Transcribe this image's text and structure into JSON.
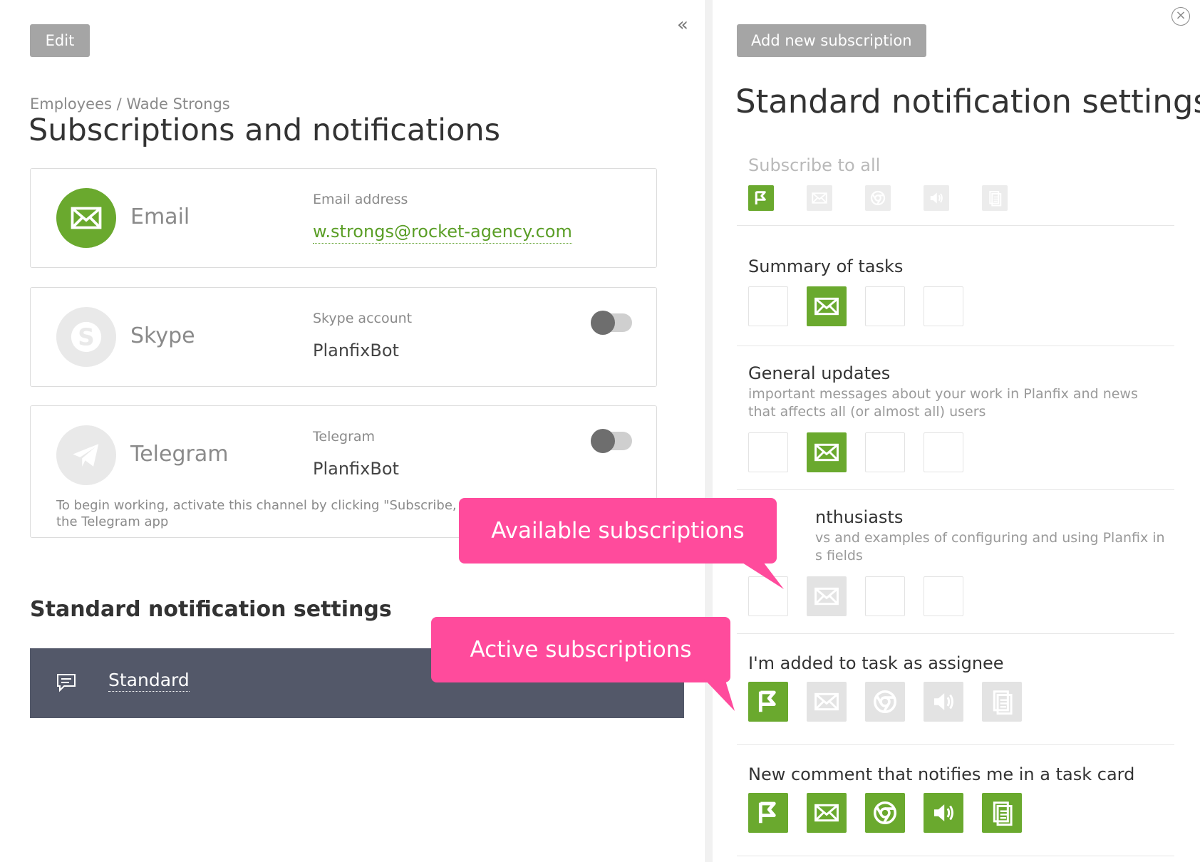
{
  "left": {
    "edit_label": "Edit",
    "collapse_icon": "«",
    "breadcrumb": "Employees / Wade Strongs",
    "title": "Subscriptions and notifications",
    "channels": {
      "email": {
        "name": "Email",
        "field_label": "Email address",
        "value": "w.strongs@rocket-agency.com",
        "icon": "envelope-icon"
      },
      "skype": {
        "name": "Skype",
        "field_label": "Skype account",
        "value": "PlanfixBot",
        "icon": "skype-icon",
        "enabled": false
      },
      "telegram": {
        "name": "Telegram",
        "field_label": "Telegram",
        "value": "PlanfixBot",
        "icon": "telegram-icon",
        "enabled": false,
        "note": "To begin working, activate this channel by clicking \"Subscribe,\" an",
        "note_line2": "the Telegram app"
      }
    },
    "standard_heading": "Standard notification settings",
    "standard_item": "Standard"
  },
  "right": {
    "close_icon": "×",
    "add_button": "Add new subscription",
    "title": "Standard notification settings",
    "sections": {
      "all": {
        "title": "Subscribe to all"
      },
      "summary": {
        "title": "Summary of tasks"
      },
      "general": {
        "title": "General updates",
        "desc": "important messages about your work in Planfix and news that affects all (or almost all) users"
      },
      "enthusiasts": {
        "title": "nthusiasts",
        "desc_line1": "vs and examples of configuring and using Planfix in",
        "desc_line2": "s fields"
      },
      "assignee": {
        "title": "I'm added to task as assignee"
      },
      "comment": {
        "title": "New comment that notifies me in a task card"
      }
    }
  },
  "callouts": {
    "available": "Available subscriptions",
    "active": "Active subscriptions"
  },
  "colors": {
    "accent": "#6aa92e",
    "callout": "#ff4b9c",
    "bar": "#535869"
  }
}
